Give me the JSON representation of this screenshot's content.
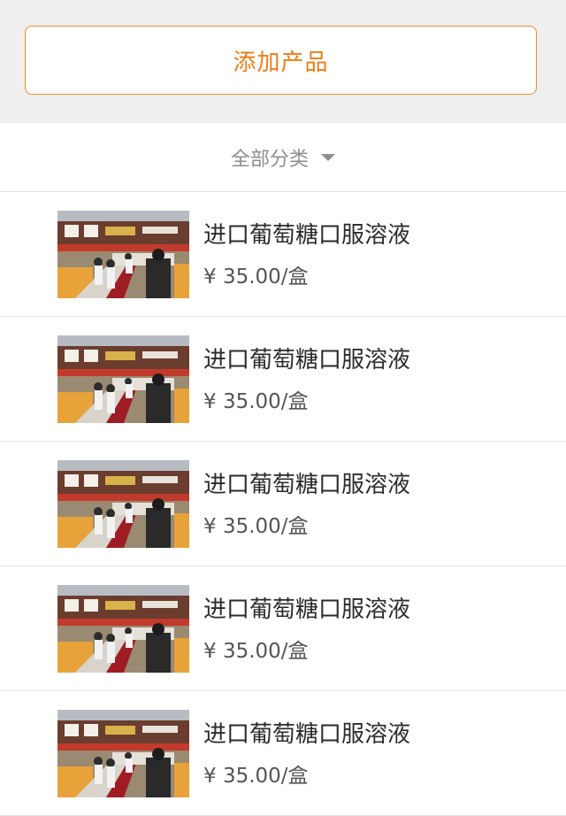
{
  "header": {
    "add_button_label": "添加产品"
  },
  "filter": {
    "category_label": "全部分类",
    "icon": "caret-down-icon"
  },
  "products": [
    {
      "name": "进口葡萄糖口服溶液",
      "price": "¥ 35.00/盒"
    },
    {
      "name": "进口葡萄糖口服溶液",
      "price": "¥ 35.00/盒"
    },
    {
      "name": "进口葡萄糖口服溶液",
      "price": "¥ 35.00/盒"
    },
    {
      "name": "进口葡萄糖口服溶液",
      "price": "¥ 35.00/盒"
    },
    {
      "name": "进口葡萄糖口服溶液",
      "price": "¥ 35.00/盒"
    }
  ],
  "colors": {
    "accent": "#ee7d17",
    "background_top": "#efefef",
    "divider": "#e3e3e3"
  }
}
